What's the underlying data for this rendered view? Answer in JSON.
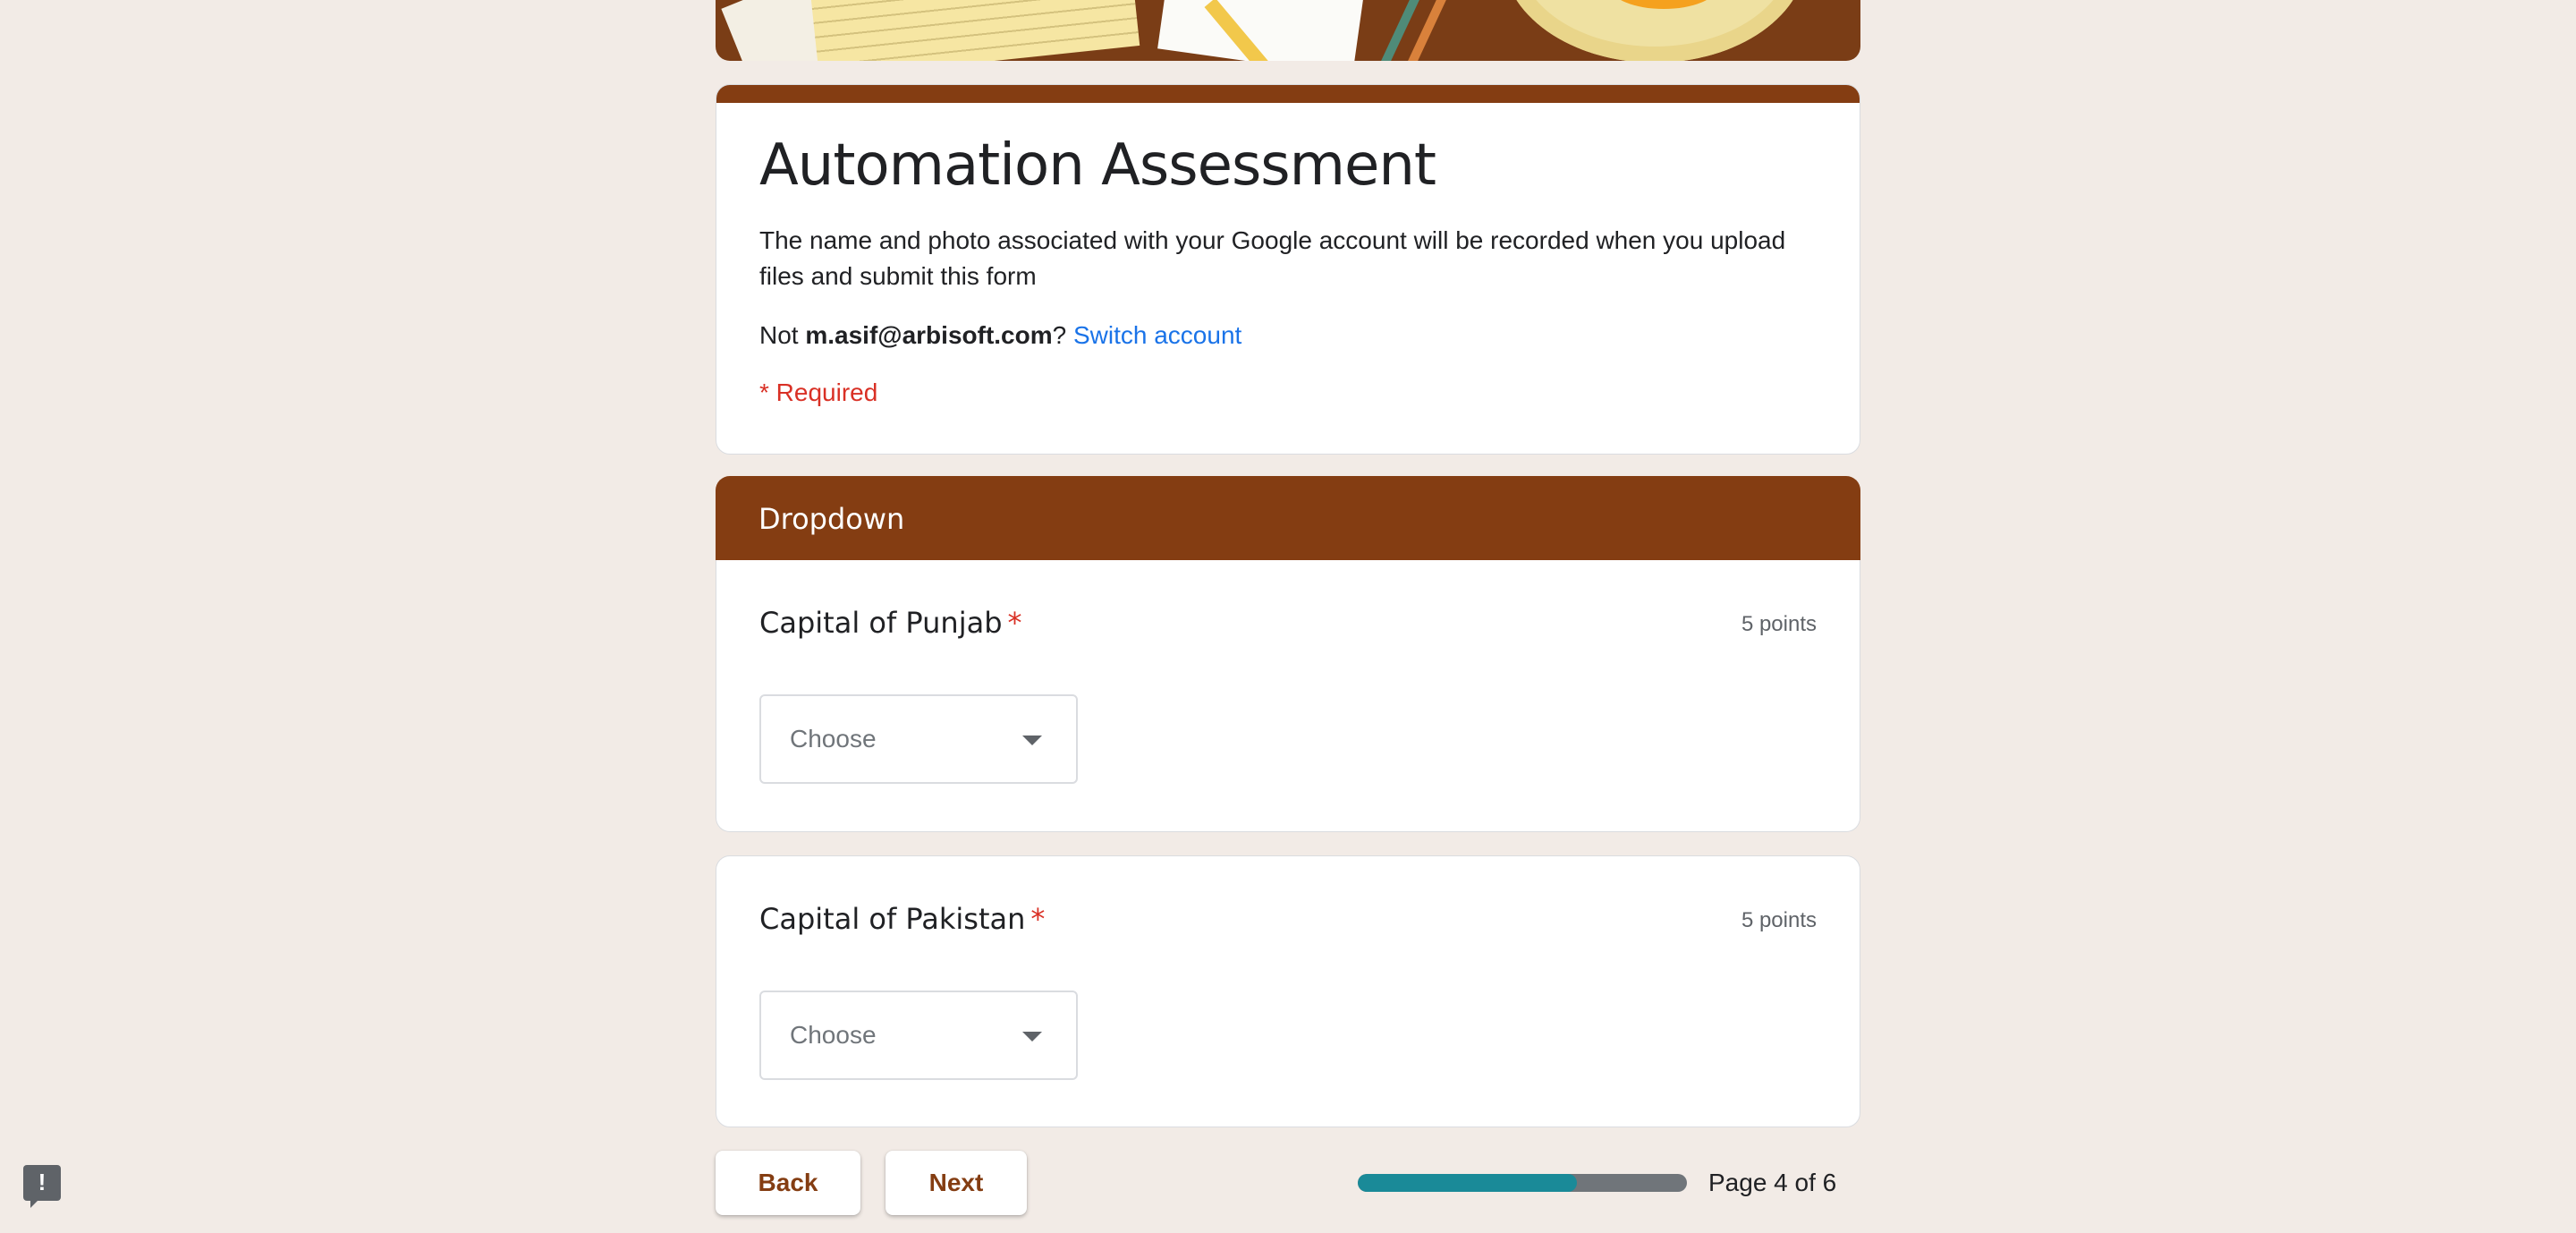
{
  "form": {
    "title": "Automation Assessment",
    "description": "The name and photo associated with your Google account will be recorded when you upload files and submit this form",
    "account_prefix": "Not ",
    "account_email": "m.asif@arbisoft.com",
    "account_suffix": "?",
    "switch_account_label": "Switch account",
    "required_note": "* Required"
  },
  "section": {
    "title": "Dropdown"
  },
  "questions": [
    {
      "title": "Capital of Punjab",
      "required_mark": "*",
      "points": "5 points",
      "placeholder": "Choose"
    },
    {
      "title": "Capital of Pakistan",
      "required_mark": "*",
      "points": "5 points",
      "placeholder": "Choose"
    }
  ],
  "navigation": {
    "back_label": "Back",
    "next_label": "Next",
    "page_indicator": "Page 4 of 6",
    "progress_fraction": 0.667
  },
  "feedback": {
    "icon": "report-issue-icon",
    "glyph": "!"
  },
  "colors": {
    "theme": "#843d12",
    "background": "#f2ebe6",
    "required": "#d93025",
    "link": "#1a73e8",
    "progress": "#1a8a98"
  }
}
